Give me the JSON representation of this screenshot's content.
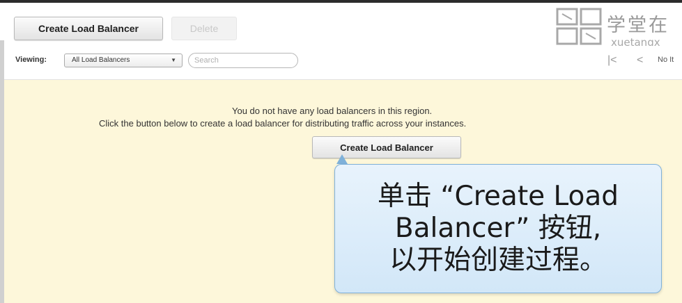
{
  "toolbar": {
    "create_label": "Create Load Balancer",
    "delete_label": "Delete"
  },
  "watermark": {
    "cn_text": "学堂在",
    "en_text": "xuetangx"
  },
  "filter": {
    "viewing_label": "Viewing:",
    "viewing_value": "All Load Balancers",
    "search_placeholder": "Search"
  },
  "pager": {
    "first_glyph": "|<",
    "prev_glyph": "<",
    "text": "No It"
  },
  "empty_state": {
    "line1": "You do not have any load balancers in this region.",
    "line2": "Click the button below to create a load balancer for distributing traffic across your instances.",
    "button_label": "Create Load Balancer"
  },
  "callout": {
    "line1": "单击 “Create Load",
    "line2": "Balancer” 按钮,",
    "line3": "以开始创建过程。"
  },
  "colors": {
    "panel_bg": "#fdf7da",
    "callout_bg": "#dcecf9",
    "callout_border": "#7fb1d9"
  }
}
